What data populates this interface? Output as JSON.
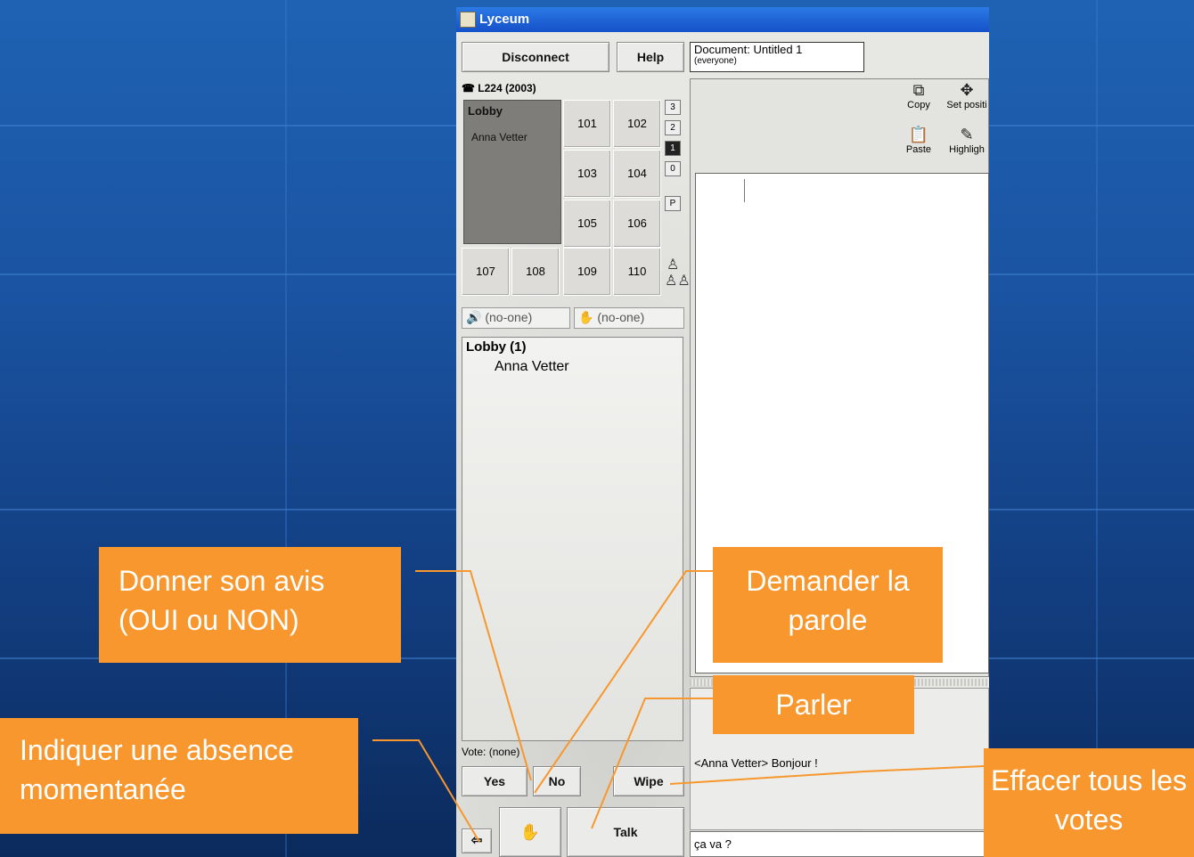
{
  "window": {
    "title": "Lyceum"
  },
  "toolbar": {
    "disconnect": "Disconnect",
    "help": "Help"
  },
  "document": {
    "line1": "Document: Untitled 1",
    "line2": "(everyone)"
  },
  "room_header": "L224 (2003)",
  "lobby": {
    "name": "Lobby",
    "member": "Anna Vetter"
  },
  "rooms": [
    "101",
    "102",
    "103",
    "104",
    "105",
    "106",
    "107",
    "108",
    "109",
    "110"
  ],
  "floors": [
    "3",
    "2",
    "1",
    "0",
    "P"
  ],
  "status": {
    "speaker": "(no-one)",
    "hand": "(no-one)"
  },
  "participants": {
    "header": "Lobby (1)",
    "members": [
      "Anna Vetter"
    ]
  },
  "tools": {
    "copy": "Copy",
    "set_position": "Set positi",
    "paste": "Paste",
    "highlight": "Highligh"
  },
  "vote": {
    "label": "Vote: (none)",
    "yes": "Yes",
    "no": "No",
    "wipe": "Wipe",
    "talk": "Talk"
  },
  "chat": {
    "message": "<Anna Vetter> Bonjour !",
    "input": "ça va ?"
  },
  "callouts": {
    "avis": "Donner son avis (OUI ou NON)",
    "absence": "Indiquer une absence momentanée",
    "parole": "Demander la parole",
    "parler": "Parler",
    "effacer": "Effacer tous les votes"
  },
  "colors": {
    "callout": "#f7972d",
    "background": "#1a53a1",
    "titlebar": "#1550c8"
  }
}
